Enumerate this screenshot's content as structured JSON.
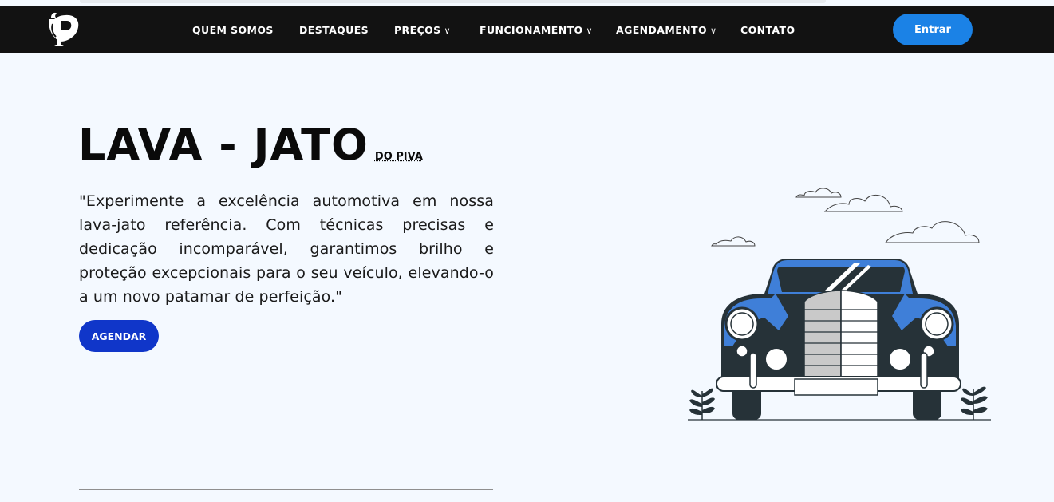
{
  "nav": {
    "items": [
      {
        "label": "QUEM SOMOS",
        "dropdown": false
      },
      {
        "label": "DESTAQUES",
        "dropdown": false
      },
      {
        "label": "PREÇOS",
        "dropdown": true
      },
      {
        "label": "FUNCIONAMENTO",
        "dropdown": true
      },
      {
        "label": "AGENDAMENTO",
        "dropdown": true
      },
      {
        "label": "CONTATO",
        "dropdown": false
      }
    ],
    "login_label": "Entrar"
  },
  "hero": {
    "title": "LAVA - JATO",
    "title_suffix": "DO PIVA",
    "text": "\"Experimente a excelência automotiva em nossa lava-jato referência. Com técnicas precisas e dedicação incomparável, garantimos brilho e proteção excepcionais para o seu veículo, elevando-o a um novo patamar de perfeição.\"",
    "cta_label": "AGENDAR"
  },
  "colors": {
    "navbar": "#121212",
    "accent_login": "#1b82e6",
    "accent_cta": "#1036c9",
    "car_blue": "#3f7fd8",
    "car_dark": "#263238"
  }
}
